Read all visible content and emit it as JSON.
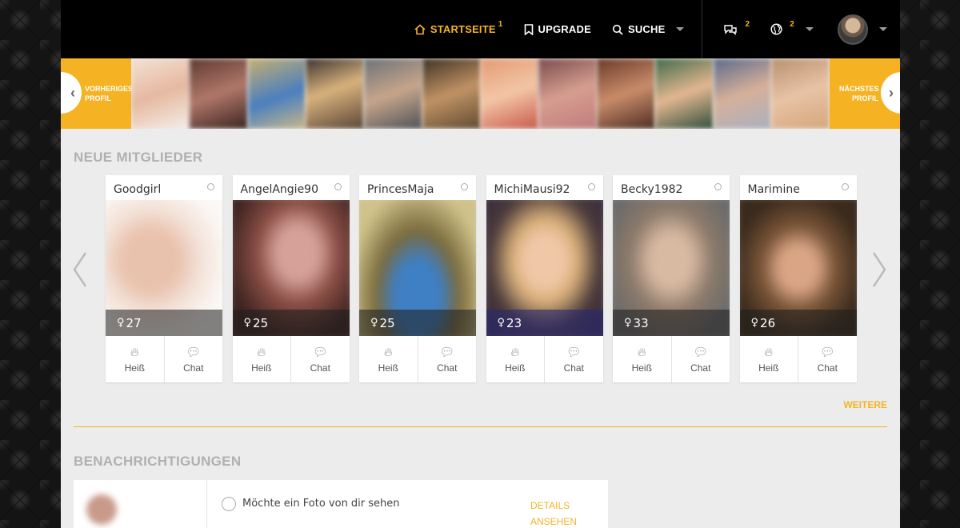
{
  "header": {
    "nav": [
      {
        "label": "STARTSEITE",
        "badge": "1",
        "icon": "home-icon",
        "active": true
      },
      {
        "label": "UPGRADE",
        "badge": "",
        "icon": "bookmark-icon",
        "active": false
      },
      {
        "label": "SUCHE",
        "badge": "",
        "icon": "search-icon",
        "active": false
      }
    ],
    "messages_badge": "2",
    "globe_badge": "2"
  },
  "strip": {
    "prev_label_1": "VORHERIGES",
    "prev_label_2": "PROFIL",
    "next_label_1": "NÄCHSTES",
    "next_label_2": "PROFIL"
  },
  "new_members": {
    "title": "NEUE MITGLIEDER",
    "members": [
      {
        "name": "Goodgirl",
        "age": "27"
      },
      {
        "name": "AngelAngie90",
        "age": "25"
      },
      {
        "name": "PrincesMaja",
        "age": "25"
      },
      {
        "name": "MichiMausi92",
        "age": "23"
      },
      {
        "name": "Becky1982",
        "age": "33"
      },
      {
        "name": "Marimine",
        "age": "26"
      }
    ],
    "hot_label": "Heiß",
    "chat_label": "Chat",
    "more_label": "WEITERE"
  },
  "notifications": {
    "title": "BENACHRICHTIGUNGEN",
    "items": [
      {
        "text": "Möchte ein Foto von dir sehen",
        "link_1": "DETAILS",
        "link_2": "ANSEHEN"
      }
    ]
  },
  "colors": {
    "accent": "#f5b324",
    "header_bg": "#000000",
    "content_bg": "#ececec"
  }
}
